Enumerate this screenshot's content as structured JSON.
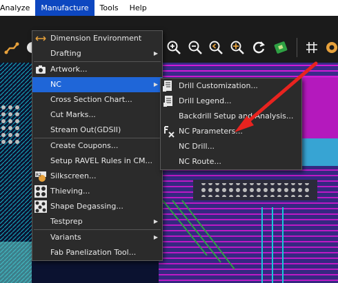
{
  "menubar": {
    "items": [
      "Analyze",
      "Manufacture",
      "Tools",
      "Help"
    ],
    "active": "Manufacture"
  },
  "manufacture_menu": {
    "items": [
      {
        "label": "Dimension Environment",
        "icon": "dimension-icon",
        "submenu": false
      },
      {
        "label": "Drafting",
        "submenu": true
      },
      {
        "label": "Artwork...",
        "icon": "camera-icon",
        "submenu": false
      },
      {
        "label": "NC",
        "submenu": true,
        "highlighted": true
      },
      {
        "label": "Cross Section Chart...",
        "submenu": false
      },
      {
        "label": "Cut Marks...",
        "submenu": false
      },
      {
        "label": "Stream Out(GDSII)",
        "submenu": false
      },
      {
        "label": "Create Coupons...",
        "submenu": false
      },
      {
        "label": "Setup RAVEL Rules in CM...",
        "submenu": false
      },
      {
        "label": "Silkscreen...",
        "icon": "silkscreen-icon",
        "submenu": false
      },
      {
        "label": "Thieving...",
        "icon": "thieving-icon",
        "submenu": false
      },
      {
        "label": "Shape Degassing...",
        "icon": "degassing-icon",
        "submenu": false
      },
      {
        "label": "Testprep",
        "submenu": true
      },
      {
        "label": "Variants",
        "submenu": true
      },
      {
        "label": "Fab Panelization Tool...",
        "submenu": false
      }
    ]
  },
  "nc_menu": {
    "items": [
      {
        "label": "Drill Customization...",
        "icon": "drill-customization-icon"
      },
      {
        "label": "Drill Legend...",
        "icon": "drill-legend-icon"
      },
      {
        "label": "Backdrill Setup and Analysis..."
      },
      {
        "label": "NC Parameters...",
        "icon": "nc-parameters-icon"
      },
      {
        "label": "NC Drill..."
      },
      {
        "label": "NC Route..."
      }
    ]
  },
  "colors": {
    "menu_bg": "#2b2b2b",
    "highlight": "#1f66d8",
    "menubar_active": "#0d47c0",
    "annotation_arrow": "#e8231f",
    "pcb_magenta": "#d21bd6",
    "pcb_cyan": "#18c7d8",
    "pcb_green": "#2ea043"
  }
}
